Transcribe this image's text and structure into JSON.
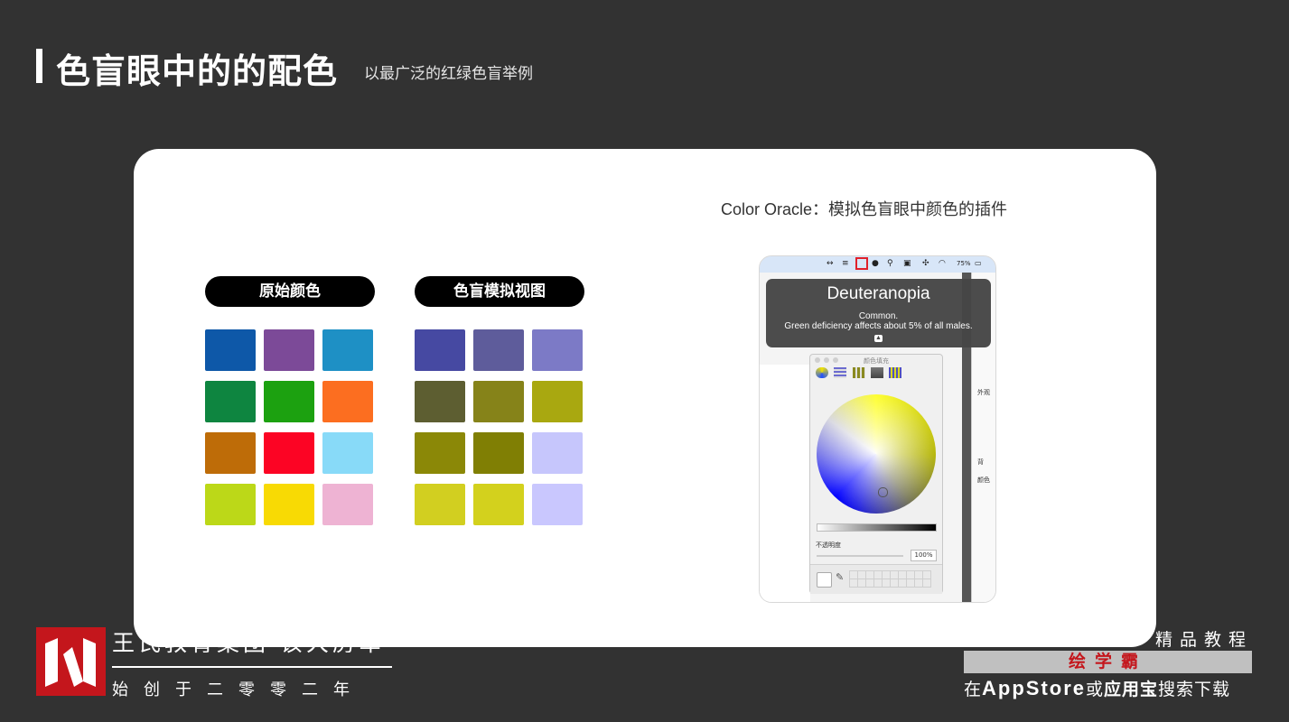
{
  "header": {
    "title": "色盲眼中的的配色",
    "subtitle": "以最广泛的红绿色盲举例"
  },
  "original": {
    "label": "原始颜色",
    "colors": [
      [
        "#0E58A8",
        "#7C4A98",
        "#1E90C5"
      ],
      [
        "#0E8540",
        "#1CA110",
        "#FC6E20"
      ],
      [
        "#BE6C08",
        "#FC0424",
        "#88DAF8"
      ],
      [
        "#BCD818",
        "#F8DA04",
        "#EEB3D3"
      ]
    ]
  },
  "simulated": {
    "label": "色盲模拟视图",
    "colors": [
      [
        "#4649A2",
        "#5E5C9B",
        "#7C7AC6"
      ],
      [
        "#5D5E31",
        "#868319",
        "#A9A810"
      ],
      [
        "#8B8807",
        "#807F04",
        "#C6C6FC"
      ],
      [
        "#D2CF20",
        "#D3D11D",
        "#C9C7FE"
      ]
    ]
  },
  "oracle": {
    "caption": "Color Oracle：模拟色盲眼中颜色的插件",
    "menubar_battery": "75%",
    "popup_title": "Deuteranopia",
    "popup_line1": "Common.",
    "popup_line2": "Green deficiency affects about 5% of all males.",
    "picker_title": "颜色填充",
    "opacity_label": "不透明度",
    "opacity_value": "100%",
    "side_label_1": "外观",
    "side_label_2": "背",
    "side_label_3": "颜色"
  },
  "footer": {
    "brand_name": "王氏教育集团·该大房军",
    "since": "始创于二零零二年",
    "right_top": "精品教程",
    "right_app": "绘学霸",
    "right_bottom_prefix": "在",
    "right_bottom_store": "AppStore",
    "right_bottom_or": "或",
    "right_bottom_app": "应用宝",
    "right_bottom_suffix": "搜索下载"
  }
}
